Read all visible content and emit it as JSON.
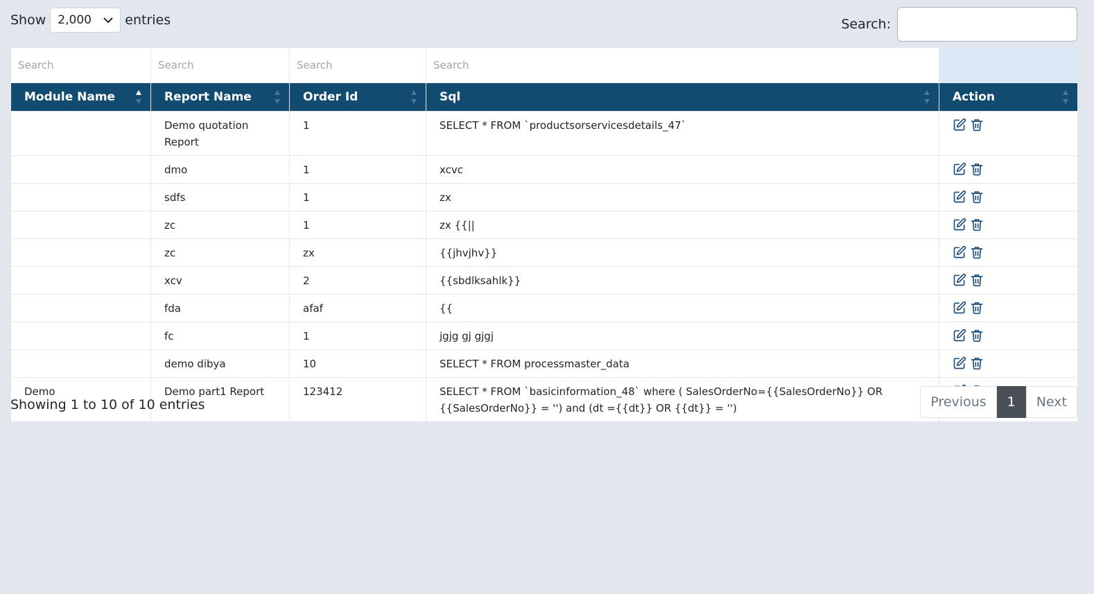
{
  "length_menu": {
    "show_label": "Show",
    "value": "2,000",
    "entries_label": "entries"
  },
  "search": {
    "label": "Search:",
    "value": ""
  },
  "filters": {
    "placeholder": "Search"
  },
  "columns": [
    "Module Name",
    "Report Name",
    "Order Id",
    "Sql",
    "Action"
  ],
  "rows": [
    {
      "module": "",
      "report": "Demo quotation Report",
      "order_id": "1",
      "sql": "SELECT * FROM `productsorservicesdetails_47`"
    },
    {
      "module": "",
      "report": "dmo",
      "order_id": "1",
      "sql": "xcvc"
    },
    {
      "module": "",
      "report": "sdfs",
      "order_id": "1",
      "sql": "zx"
    },
    {
      "module": "",
      "report": "zc",
      "order_id": "1",
      "sql": "zx {{||"
    },
    {
      "module": "",
      "report": "zc",
      "order_id": "zx",
      "sql": "{{jhvjhv}}"
    },
    {
      "module": "",
      "report": "xcv",
      "order_id": "2",
      "sql": "{{sbdlksahlk}}"
    },
    {
      "module": "",
      "report": "fda",
      "order_id": "afaf",
      "sql": "{{"
    },
    {
      "module": "",
      "report": "fc",
      "order_id": "1",
      "sql": "jgjg gj gjgj"
    },
    {
      "module": "",
      "report": "demo dibya",
      "order_id": "10",
      "sql": "SELECT * FROM processmaster_data"
    },
    {
      "module": "Demo",
      "report": "Demo part1 Report",
      "order_id": "123412",
      "sql": "SELECT * FROM `basicinformation_48` where ( SalesOrderNo={{SalesOrderNo}} OR {{SalesOrderNo}} = '') and (dt ={{dt}} OR {{dt}} = '')"
    }
  ],
  "info": "Showing 1 to 10 of 10 entries",
  "pagination": {
    "previous": "Previous",
    "current": "1",
    "next": "Next"
  },
  "colors": {
    "header_bg": "#114b6f",
    "page_bg": "#e2e7ee",
    "edit_icon": "#1f4e79",
    "delete_icon": "#1f4e79"
  },
  "icons": {
    "edit": "edit-icon",
    "delete": "trash-icon",
    "sort": "sort-icon",
    "select": "chevron-down-icon"
  }
}
